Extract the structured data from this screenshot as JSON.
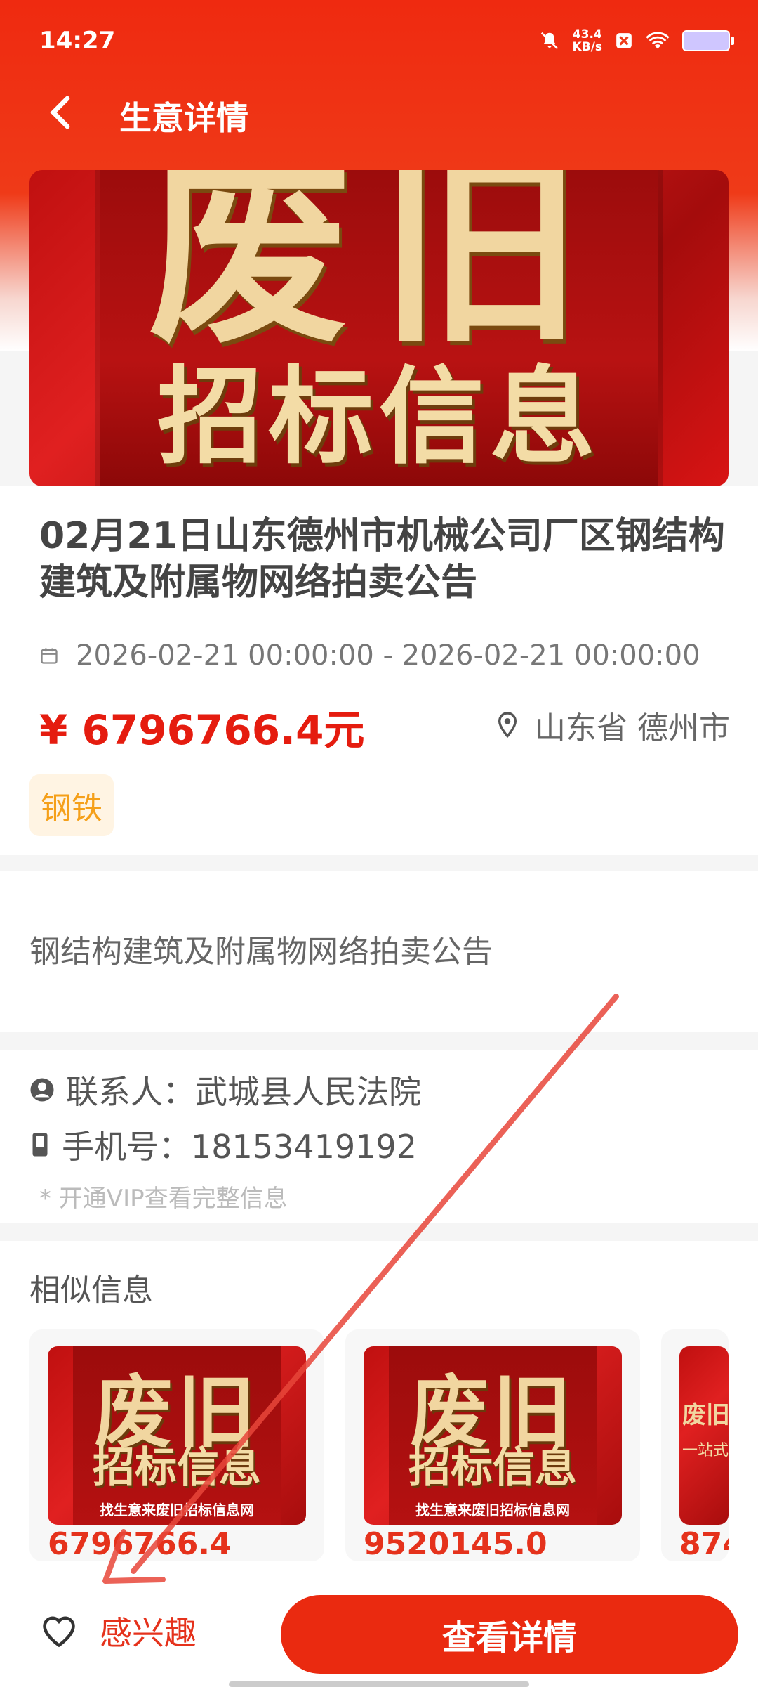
{
  "status_bar": {
    "time": "14:27",
    "net_speed_top": "43.4",
    "net_speed_bottom": "KB/s"
  },
  "nav": {
    "title": "生意详情"
  },
  "banner": {
    "big_text": "废旧",
    "sub_text": "招标信息"
  },
  "listing": {
    "title": "02月21日山东德州市机械公司厂区钢结构建筑及附属物网络拍卖公告",
    "date_range": "2026-02-21 00:00:00 - 2026-02-21 00:00:00",
    "price": "¥ 6796766.4元",
    "location": "山东省 德州市",
    "tag": "钢铁"
  },
  "description": {
    "text": "钢结构建筑及附属物网络拍卖公告"
  },
  "contact": {
    "person_label": "联系人：武城县人民法院",
    "phone_label": "手机号：18153419192",
    "vip_note": "* 开通VIP查看完整信息"
  },
  "similar": {
    "title": "相似信息",
    "items": [
      {
        "big": "废旧",
        "sub": "招标信息",
        "foot": "找生意来废旧招标信息网",
        "price": "6796766.4"
      },
      {
        "big": "废旧",
        "sub": "招标信息",
        "foot": "找生意来废旧招标信息网",
        "price": "9520145.0"
      },
      {
        "big": "废旧",
        "sub": "一站式",
        "foot": "",
        "price": "874"
      }
    ]
  },
  "bottom": {
    "interest_label": "感兴趣",
    "detail_label": "查看详情"
  },
  "colors": {
    "accent": "#ea2a10",
    "price_red": "#e51c0f",
    "tag_orange": "#f5a01a"
  }
}
